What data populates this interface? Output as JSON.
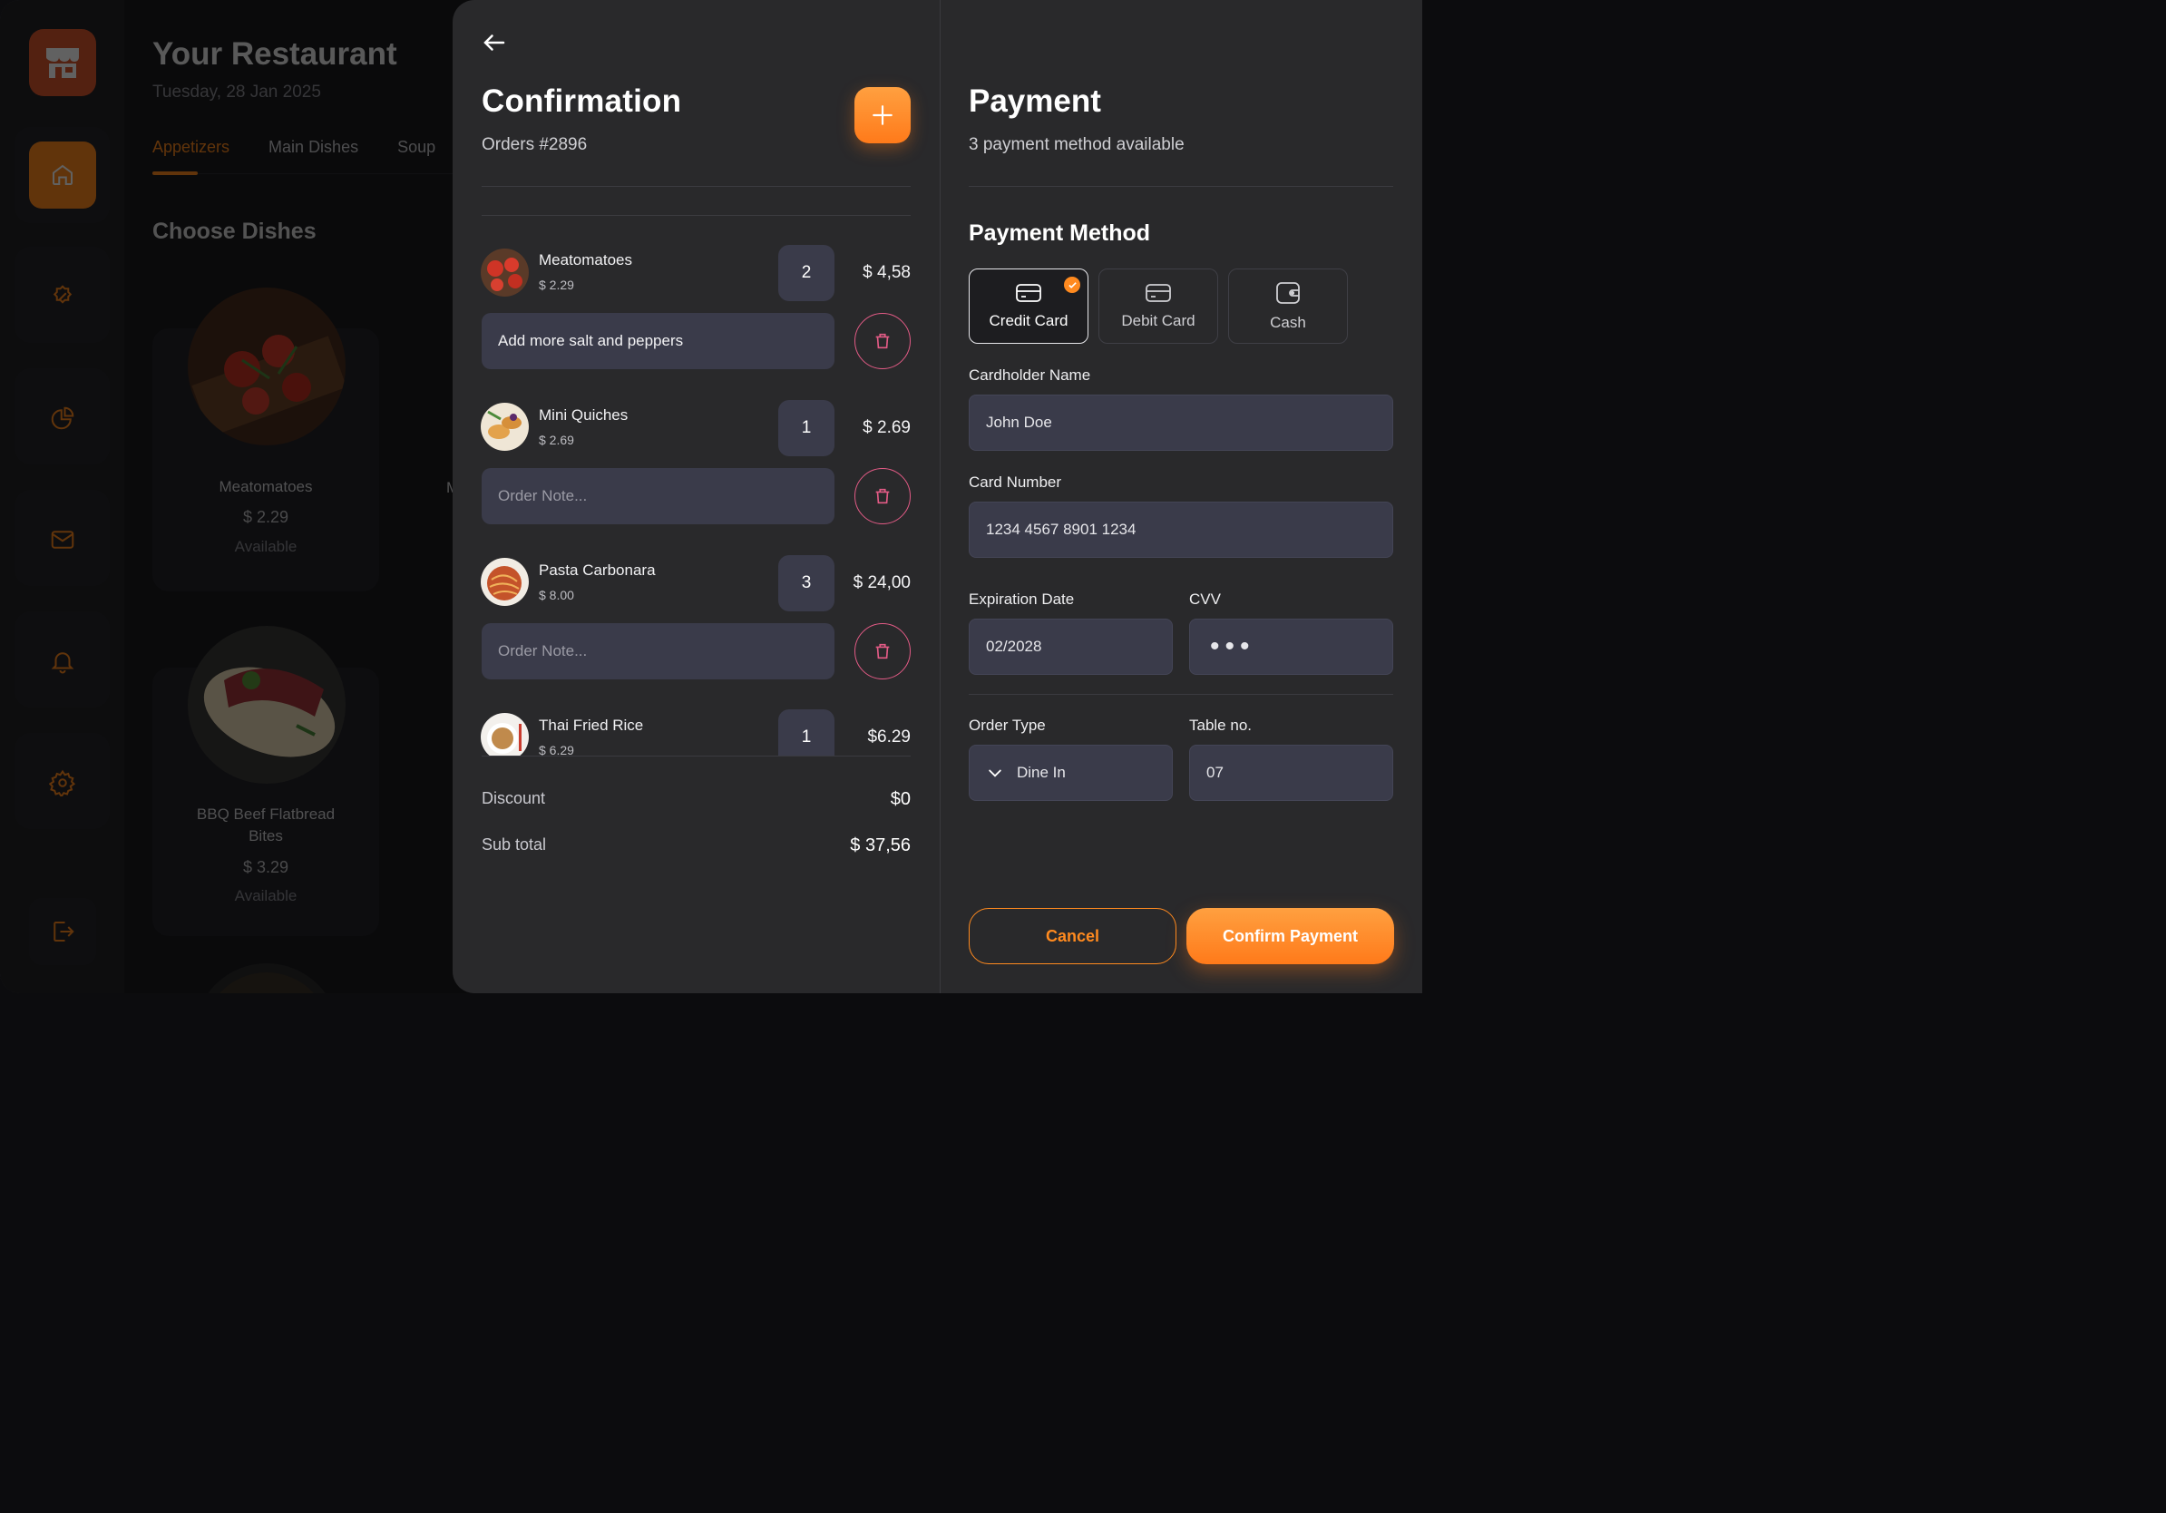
{
  "background": {
    "restaurant_title": "Your Restaurant",
    "date": "Tuesday, 28 Jan 2025",
    "tabs": [
      {
        "label": "Appetizers",
        "active": true
      },
      {
        "label": "Main Dishes",
        "active": false
      },
      {
        "label": "Soup",
        "active": false
      }
    ],
    "section_title": "Choose Dishes",
    "dishes": [
      {
        "name": "Meatomatoes",
        "price": "$ 2.29",
        "status": "Available"
      },
      {
        "name": "BBQ Beef Flatbread Bites",
        "price": "$ 3.29",
        "status": "Available"
      }
    ],
    "partial_dish_label": "M",
    "sidebar_icons": [
      "store-icon",
      "home-icon",
      "discount-icon",
      "chart-icon",
      "mail-icon",
      "bell-icon",
      "settings-icon",
      "logout-icon"
    ]
  },
  "confirmation": {
    "title": "Confirmation",
    "order_number": "Orders #2896",
    "items": [
      {
        "name": "Meatomatoes",
        "unit_price": "$ 2.29",
        "qty": "2",
        "total": "$ 4,58",
        "note": "Add more salt and peppers",
        "note_placeholder": "Order Note..."
      },
      {
        "name": "Mini Quiches",
        "unit_price": "$ 2.69",
        "qty": "1",
        "total": "$ 2.69",
        "note": "",
        "note_placeholder": "Order Note..."
      },
      {
        "name": "Pasta Carbonara",
        "unit_price": "$ 8.00",
        "qty": "3",
        "total": "$ 24,00",
        "note": "",
        "note_placeholder": "Order Note..."
      },
      {
        "name": "Thai Fried Rice",
        "unit_price": "$ 6.29",
        "qty": "1",
        "total": "$6.29"
      }
    ],
    "discount_label": "Discount",
    "discount_value": "$0",
    "subtotal_label": "Sub total",
    "subtotal_value": "$ 37,56"
  },
  "payment": {
    "title": "Payment",
    "subtitle": "3 payment method available",
    "method_title": "Payment Method",
    "methods": [
      {
        "label": "Credit Card",
        "icon": "credit-card-icon",
        "selected": true
      },
      {
        "label": "Debit Card",
        "icon": "debit-card-icon",
        "selected": false
      },
      {
        "label": "Cash",
        "icon": "wallet-icon",
        "selected": false
      }
    ],
    "cardholder_label": "Cardholder Name",
    "cardholder_value": "John Doe",
    "card_number_label": "Card Number",
    "card_number_value": "1234 4567 8901 1234",
    "expiration_label": "Expiration Date",
    "expiration_value": "02/2028",
    "cvv_label": "CVV",
    "cvv_value": "•••",
    "order_type_label": "Order Type",
    "order_type_value": "Dine In",
    "table_label": "Table no.",
    "table_value": "07",
    "cancel_label": "Cancel",
    "confirm_label": "Confirm Payment"
  },
  "colors": {
    "accent": "#ff8a1f",
    "danger_outline": "#e35b86",
    "panel": "#29292b",
    "field": "#3a3b4a"
  }
}
